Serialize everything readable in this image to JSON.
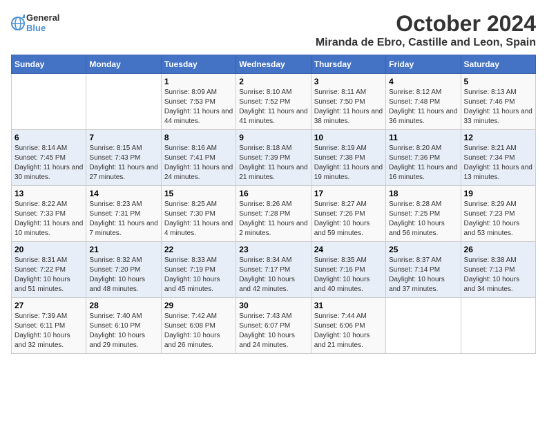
{
  "logo": {
    "line1": "General",
    "line2": "Blue"
  },
  "title": "October 2024",
  "location": "Miranda de Ebro, Castille and Leon, Spain",
  "weekdays": [
    "Sunday",
    "Monday",
    "Tuesday",
    "Wednesday",
    "Thursday",
    "Friday",
    "Saturday"
  ],
  "weeks": [
    [
      {
        "day": "",
        "info": ""
      },
      {
        "day": "",
        "info": ""
      },
      {
        "day": "1",
        "info": "Sunrise: 8:09 AM\nSunset: 7:53 PM\nDaylight: 11 hours and 44 minutes."
      },
      {
        "day": "2",
        "info": "Sunrise: 8:10 AM\nSunset: 7:52 PM\nDaylight: 11 hours and 41 minutes."
      },
      {
        "day": "3",
        "info": "Sunrise: 8:11 AM\nSunset: 7:50 PM\nDaylight: 11 hours and 38 minutes."
      },
      {
        "day": "4",
        "info": "Sunrise: 8:12 AM\nSunset: 7:48 PM\nDaylight: 11 hours and 36 minutes."
      },
      {
        "day": "5",
        "info": "Sunrise: 8:13 AM\nSunset: 7:46 PM\nDaylight: 11 hours and 33 minutes."
      }
    ],
    [
      {
        "day": "6",
        "info": "Sunrise: 8:14 AM\nSunset: 7:45 PM\nDaylight: 11 hours and 30 minutes."
      },
      {
        "day": "7",
        "info": "Sunrise: 8:15 AM\nSunset: 7:43 PM\nDaylight: 11 hours and 27 minutes."
      },
      {
        "day": "8",
        "info": "Sunrise: 8:16 AM\nSunset: 7:41 PM\nDaylight: 11 hours and 24 minutes."
      },
      {
        "day": "9",
        "info": "Sunrise: 8:18 AM\nSunset: 7:39 PM\nDaylight: 11 hours and 21 minutes."
      },
      {
        "day": "10",
        "info": "Sunrise: 8:19 AM\nSunset: 7:38 PM\nDaylight: 11 hours and 19 minutes."
      },
      {
        "day": "11",
        "info": "Sunrise: 8:20 AM\nSunset: 7:36 PM\nDaylight: 11 hours and 16 minutes."
      },
      {
        "day": "12",
        "info": "Sunrise: 8:21 AM\nSunset: 7:34 PM\nDaylight: 11 hours and 13 minutes."
      }
    ],
    [
      {
        "day": "13",
        "info": "Sunrise: 8:22 AM\nSunset: 7:33 PM\nDaylight: 11 hours and 10 minutes."
      },
      {
        "day": "14",
        "info": "Sunrise: 8:23 AM\nSunset: 7:31 PM\nDaylight: 11 hours and 7 minutes."
      },
      {
        "day": "15",
        "info": "Sunrise: 8:25 AM\nSunset: 7:30 PM\nDaylight: 11 hours and 4 minutes."
      },
      {
        "day": "16",
        "info": "Sunrise: 8:26 AM\nSunset: 7:28 PM\nDaylight: 11 hours and 2 minutes."
      },
      {
        "day": "17",
        "info": "Sunrise: 8:27 AM\nSunset: 7:26 PM\nDaylight: 10 hours and 59 minutes."
      },
      {
        "day": "18",
        "info": "Sunrise: 8:28 AM\nSunset: 7:25 PM\nDaylight: 10 hours and 56 minutes."
      },
      {
        "day": "19",
        "info": "Sunrise: 8:29 AM\nSunset: 7:23 PM\nDaylight: 10 hours and 53 minutes."
      }
    ],
    [
      {
        "day": "20",
        "info": "Sunrise: 8:31 AM\nSunset: 7:22 PM\nDaylight: 10 hours and 51 minutes."
      },
      {
        "day": "21",
        "info": "Sunrise: 8:32 AM\nSunset: 7:20 PM\nDaylight: 10 hours and 48 minutes."
      },
      {
        "day": "22",
        "info": "Sunrise: 8:33 AM\nSunset: 7:19 PM\nDaylight: 10 hours and 45 minutes."
      },
      {
        "day": "23",
        "info": "Sunrise: 8:34 AM\nSunset: 7:17 PM\nDaylight: 10 hours and 42 minutes."
      },
      {
        "day": "24",
        "info": "Sunrise: 8:35 AM\nSunset: 7:16 PM\nDaylight: 10 hours and 40 minutes."
      },
      {
        "day": "25",
        "info": "Sunrise: 8:37 AM\nSunset: 7:14 PM\nDaylight: 10 hours and 37 minutes."
      },
      {
        "day": "26",
        "info": "Sunrise: 8:38 AM\nSunset: 7:13 PM\nDaylight: 10 hours and 34 minutes."
      }
    ],
    [
      {
        "day": "27",
        "info": "Sunrise: 7:39 AM\nSunset: 6:11 PM\nDaylight: 10 hours and 32 minutes."
      },
      {
        "day": "28",
        "info": "Sunrise: 7:40 AM\nSunset: 6:10 PM\nDaylight: 10 hours and 29 minutes."
      },
      {
        "day": "29",
        "info": "Sunrise: 7:42 AM\nSunset: 6:08 PM\nDaylight: 10 hours and 26 minutes."
      },
      {
        "day": "30",
        "info": "Sunrise: 7:43 AM\nSunset: 6:07 PM\nDaylight: 10 hours and 24 minutes."
      },
      {
        "day": "31",
        "info": "Sunrise: 7:44 AM\nSunset: 6:06 PM\nDaylight: 10 hours and 21 minutes."
      },
      {
        "day": "",
        "info": ""
      },
      {
        "day": "",
        "info": ""
      }
    ]
  ]
}
